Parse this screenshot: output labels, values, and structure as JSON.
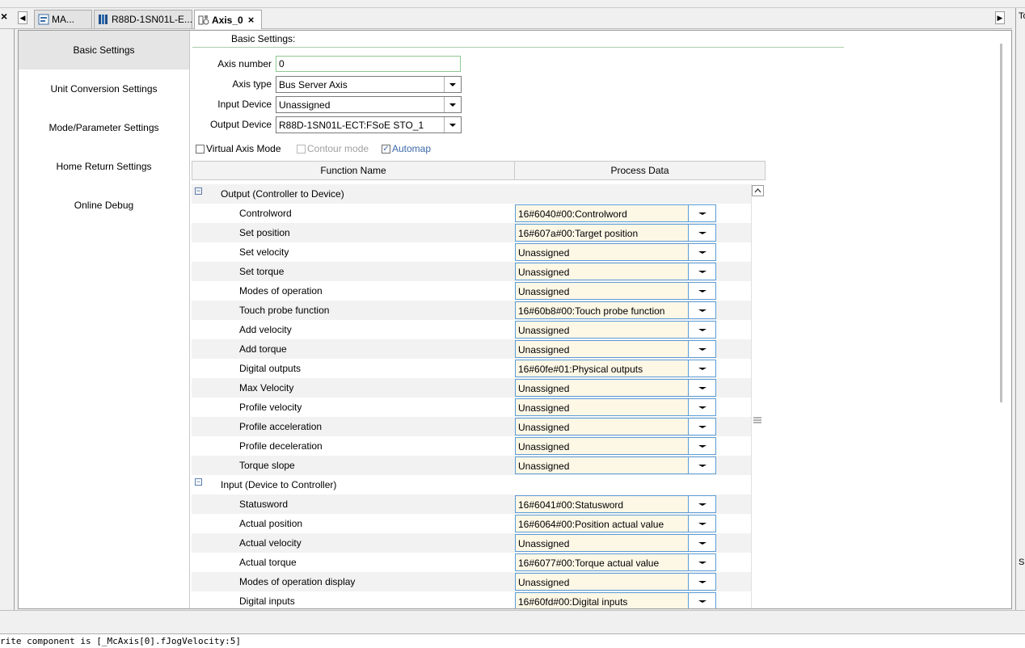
{
  "tabs": {
    "items": [
      {
        "label": "MA..."
      },
      {
        "label": "R88D-1SN01L-E..."
      },
      {
        "label": "Axis_0"
      }
    ],
    "left_close": "×",
    "tab_close": "×",
    "nav_left": "◀",
    "nav_right": "▶"
  },
  "sidebar": {
    "items": [
      {
        "label": "Basic Settings"
      },
      {
        "label": "Unit Conversion Settings"
      },
      {
        "label": "Mode/Parameter Settings"
      },
      {
        "label": "Home Return Settings"
      },
      {
        "label": "Online Debug"
      }
    ]
  },
  "basic": {
    "title": "Basic Settings:",
    "axis_number_label": "Axis number",
    "axis_number_value": "0",
    "axis_type_label": "Axis type",
    "axis_type_value": "Bus Server Axis",
    "input_device_label": "Input Device",
    "input_device_value": "Unassigned",
    "output_device_label": "Output Device",
    "output_device_value": "R88D-1SN01L-ECT:FSoE STO_1",
    "virtual_axis_label": "Virtual Axis Mode",
    "contour_label": "Contour mode",
    "automap_label": "Automap",
    "check_mark": "✓"
  },
  "table": {
    "col_function": "Function Name",
    "col_process": "Process Data",
    "collapse_glyph": "⊟",
    "groups": [
      {
        "label": "Output (Controller to Device)",
        "rows": [
          {
            "name": "Controlword",
            "value": "16#6040#00:Controlword"
          },
          {
            "name": "Set position",
            "value": "16#607a#00:Target position"
          },
          {
            "name": "Set velocity",
            "value": "Unassigned"
          },
          {
            "name": "Set torque",
            "value": "Unassigned"
          },
          {
            "name": "Modes of operation",
            "value": "Unassigned"
          },
          {
            "name": "Touch probe function",
            "value": "16#60b8#00:Touch probe function"
          },
          {
            "name": "Add velocity",
            "value": "Unassigned"
          },
          {
            "name": "Add torque",
            "value": "Unassigned"
          },
          {
            "name": "Digital outputs",
            "value": "16#60fe#01:Physical outputs"
          },
          {
            "name": "Max Velocity",
            "value": "Unassigned"
          },
          {
            "name": "Profile velocity",
            "value": "Unassigned"
          },
          {
            "name": "Profile acceleration",
            "value": "Unassigned"
          },
          {
            "name": "Profile deceleration",
            "value": "Unassigned"
          },
          {
            "name": "Torque slope",
            "value": "Unassigned"
          }
        ]
      },
      {
        "label": "Input (Device to Controller)",
        "rows": [
          {
            "name": "Statusword",
            "value": "16#6041#00:Statusword"
          },
          {
            "name": "Actual position",
            "value": "16#6064#00:Position actual value"
          },
          {
            "name": "Actual velocity",
            "value": "Unassigned"
          },
          {
            "name": "Actual torque",
            "value": "16#6077#00:Torque actual value"
          },
          {
            "name": "Modes of operation display",
            "value": "Unassigned"
          },
          {
            "name": "Digital inputs",
            "value": "16#60fd#00:Digital inputs"
          }
        ]
      }
    ]
  },
  "output_log": "rite component is [_McAxis[0].fJogVelocity:5]",
  "right_strip": {
    "top": "To",
    "bottom": "S"
  },
  "colors": {
    "pd_border": "#5b9bd5",
    "pd_fill": "#fdf7e6",
    "selected_nav": "#e5e5e5",
    "automap_text": "#3c6aa8"
  }
}
